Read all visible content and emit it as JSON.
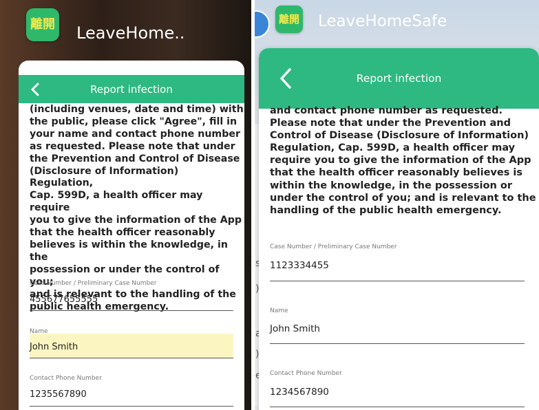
{
  "left": {
    "app_title": "LeaveHome..",
    "app_icon_glyph": "離開",
    "header": {
      "title": "Report infection",
      "back_icon": "chevron-left-icon"
    },
    "body_lines": [
      "(including venues, date and time) with",
      "the public, please click \"Agree\", fill in",
      "your name and contact phone number",
      "as requested. Please note that under",
      "the Prevention and Control of Disease",
      "(Disclosure of Information) Regulation,",
      "Cap. 599D, a health officer may require",
      "you to give the information of the App",
      "that the health officer reasonably",
      "believes is within the knowledge, in the",
      "possession or under the control of you;",
      "and is relevant to the handling of the",
      "public health emergency."
    ],
    "fields": [
      {
        "label": "Case Number / Preliminary Case Number",
        "value": "455677655555"
      },
      {
        "label": "Name",
        "value": "John Smith"
      },
      {
        "label": "Contact Phone Number",
        "value": "1235567890"
      }
    ]
  },
  "right": {
    "app_title": "LeaveHomeSafe",
    "app_icon_glyph": "離開",
    "header": {
      "title": "Report infection",
      "back_icon": "chevron-left-icon"
    },
    "body_lines": [
      "and contact phone number as requested.",
      "Please note that under the Prevention and",
      "Control of Disease (Disclosure of Information)",
      "Regulation, Cap. 599D, a health officer may",
      "require you to give the information of the App",
      "that the health officer reasonably believes is",
      "within the knowledge, in the possession or",
      "under the control of you; and is relevant to the",
      "handling of the public health emergency."
    ],
    "fields": [
      {
        "label": "Case Number / Preliminary Case Number",
        "value": "1123334455"
      },
      {
        "label": "Name",
        "value": "John Smith"
      },
      {
        "label": "Contact Phone Number",
        "value": "1234567890"
      }
    ],
    "side_chars": [
      "s",
      ")",
      "a",
      ")",
      "e"
    ]
  },
  "colors": {
    "header_green": "#2db981",
    "icon_green": "#2fb86a",
    "icon_yellow": "#f6e84a",
    "highlight": "#fbf5c2"
  }
}
